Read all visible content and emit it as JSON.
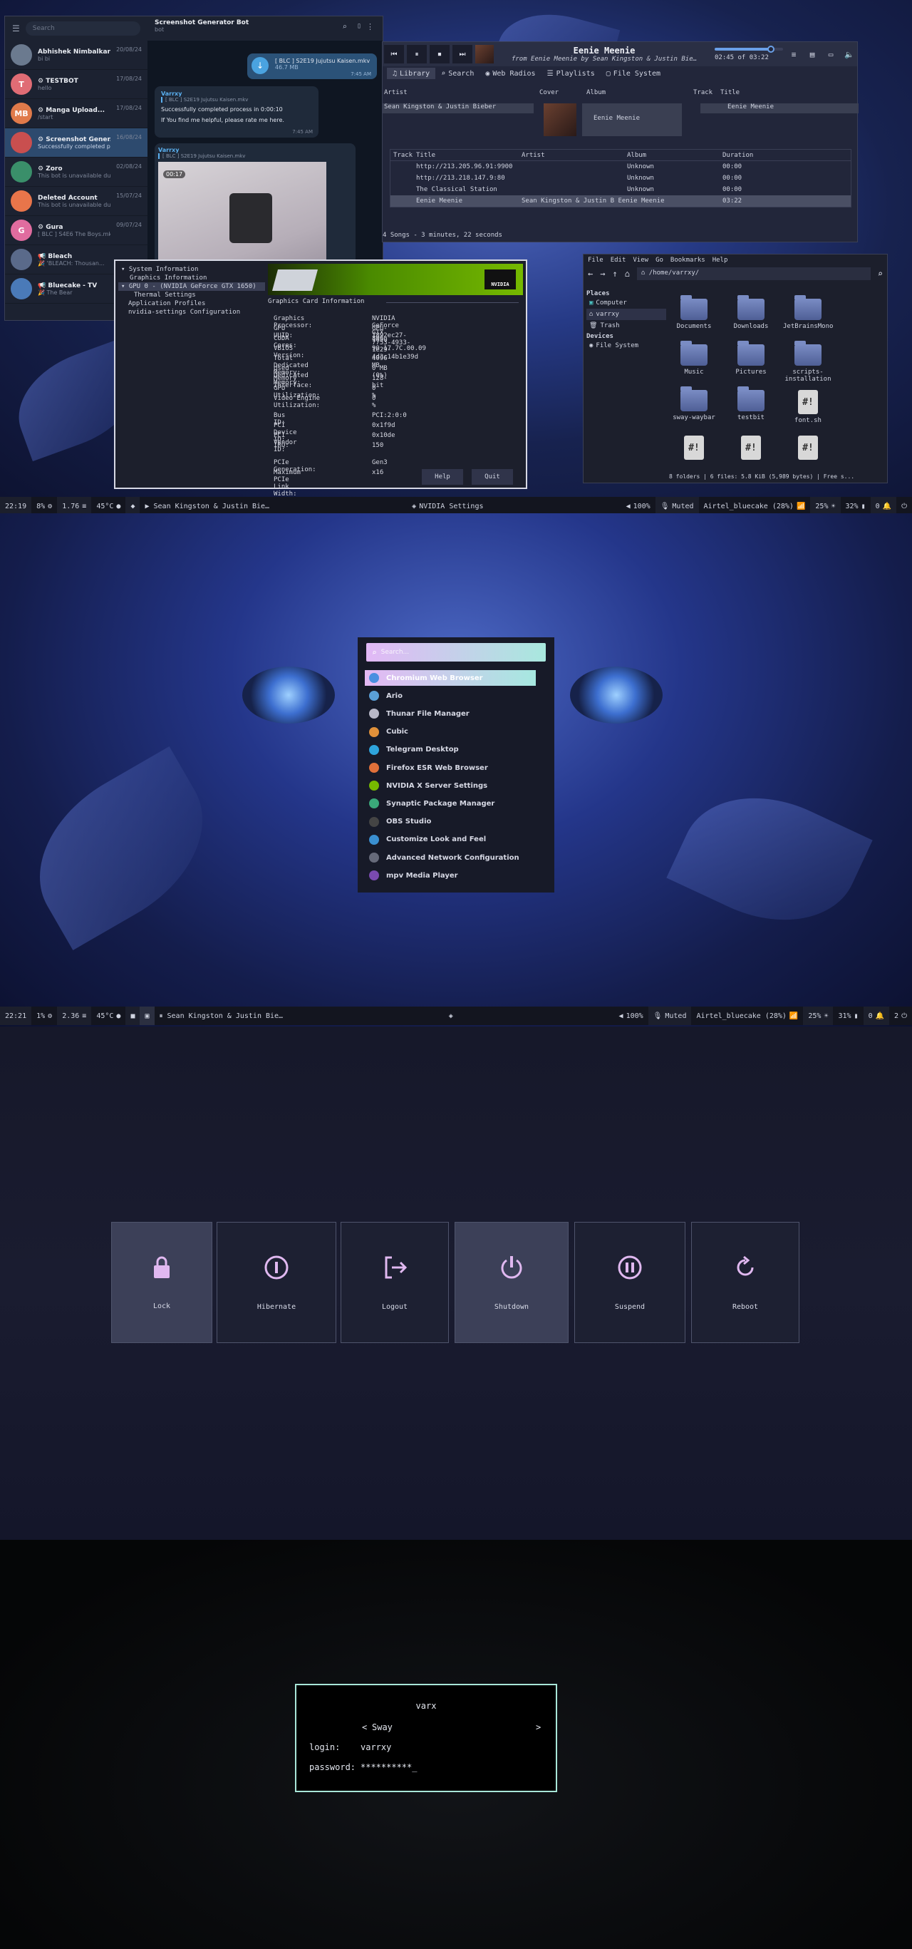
{
  "screen1": {
    "telegram": {
      "search_placeholder": "Search",
      "chat_title": "Screenshot Generator Bot",
      "chat_subtitle": "bot",
      "chats": [
        {
          "name": "Abhishek Nimbalkar",
          "preview": "bi bi",
          "date": "20/08/24",
          "avatar": "",
          "color": "#6b7a8f"
        },
        {
          "name": "⚙ TESTBOT",
          "preview": "hello",
          "date": "17/08/24",
          "avatar": "T",
          "color": "#e06c75"
        },
        {
          "name": "⚙ Manga Upload...",
          "preview": "/start",
          "date": "17/08/24",
          "avatar": "MB",
          "color": "#e07a4a"
        },
        {
          "name": "⚙ Screenshot Gener...",
          "preview": "Successfully completed process...",
          "date": "16/08/24",
          "avatar": "",
          "color": "#c94f4f"
        },
        {
          "name": "⚙ Zoro",
          "preview": "This bot is unavailable due to c...",
          "date": "02/08/24",
          "avatar": "",
          "color": "#3a8f6a"
        },
        {
          "name": "Deleted Account",
          "preview": "This bot is unavailable due to c...",
          "date": "15/07/24",
          "avatar": "",
          "color": "#e8754a"
        },
        {
          "name": "⚙ Gura",
          "preview": "[ BLC ] S4E6 The Boys.mkv",
          "date": "09/07/24",
          "avatar": "G",
          "color": "#e06c9f"
        },
        {
          "name": "📢 Bleach",
          "preview": "🎉 'BLEACH: Thousan...",
          "date": "",
          "avatar": "",
          "color": "#5a6a8a"
        },
        {
          "name": "📢 Bluecake - TV",
          "preview": "🎉 The Bear",
          "date": "",
          "avatar": "",
          "color": "#4a7ab8"
        }
      ],
      "file_name": "[ BLC ] S2E19 Jujutsu Kaisen.mkv",
      "file_size": "46.7 MB",
      "file_time": "7:45 AM",
      "msg1_sender": "Varrxy",
      "msg1_quote": "[ BLC ] S2E19 Jujutsu Kaisen.mkv",
      "msg1_text": "Successfully completed process in 0:00:10",
      "msg1_text2": "If You find me helpful, please rate me here.",
      "msg1_time": "7:45 AM",
      "msg2_sender": "Varrxy",
      "msg2_quote": "[ BLC ] S2E19 Jujutsu Kaisen.mkv",
      "video_time": "00:17"
    },
    "music": {
      "title": "Eenie Meenie",
      "subtitle": "from Eenie Meenie by Sean Kingston & Justin Bie…",
      "time": "02:45 of 03:22",
      "progress": 0.82,
      "tabs": [
        "Library",
        "Search",
        "Web Radios",
        "Playlists",
        "File System"
      ],
      "headers_top": [
        "Artist",
        "Cover",
        "Album",
        "Track",
        "Title"
      ],
      "artist_row": "Sean Kingston & Justin Bieber",
      "album_row": "Eenie Meenie",
      "title_row": "Eenie Meenie",
      "track_headers": [
        "Track",
        "Title",
        "Artist",
        "Album",
        "Duration"
      ],
      "tracks": [
        {
          "title": "http://213.205.96.91:9900",
          "artist": "",
          "album": "Unknown",
          "duration": "00:00"
        },
        {
          "title": "http://213.218.147.9:80",
          "artist": "",
          "album": "Unknown",
          "duration": "00:00"
        },
        {
          "title": "The Classical Station",
          "artist": "",
          "album": "Unknown",
          "duration": "00:00"
        },
        {
          "title": "Eenie Meenie",
          "artist": "Sean Kingston & Justin B Eenie Meenie",
          "album": "",
          "duration": "03:22"
        }
      ],
      "status": "4 Songs - 3 minutes, 22 seconds"
    },
    "nvidia": {
      "tree": [
        "System Information",
        "Graphics Information",
        "GPU 0 - (NVIDIA GeForce GTX 1650)",
        "Thermal Settings",
        "Application Profiles",
        "nvidia-settings Configuration"
      ],
      "section_title": "Graphics Card Information",
      "logo_text": "NVIDIA",
      "keys": [
        "Graphics Processor:",
        "GPU UUID:",
        "CUDA Cores:",
        "VBIOS Version:",
        "Total Dedicated Memory:",
        "Used Dedicated Memory:",
        "Memory Interface:",
        "GPU Utilization:",
        "Video Engine Utilization:",
        "Bus ID:",
        "PCI Device ID:",
        "PCI Vendor ID:",
        "IRQ:",
        "PCIe Generation:",
        "Maximum PCIe Link Width:"
      ],
      "values": [
        "NVIDIA GeForce GTX 1650",
        "GPU-1892ec27-7753-4933-1e29-4d3c14b1e39d",
        "896",
        "90.17.7C.00.09",
        "4096 MB",
        "0 MB (0%)",
        "128-bit",
        "0 %",
        "0 %",
        "PCI:2:0:0",
        "0x1f9d",
        "0x10de",
        "150",
        "Gen3",
        "x16"
      ],
      "help": "Help",
      "quit": "Quit"
    },
    "files": {
      "menu": [
        "File",
        "Edit",
        "View",
        "Go",
        "Bookmarks",
        "Help"
      ],
      "path": "/home/varrxy/",
      "places_label": "Places",
      "places": [
        "Computer",
        "varrxy",
        "Trash"
      ],
      "devices_label": "Devices",
      "devices": [
        "File System"
      ],
      "items": [
        "Documents",
        "Downloads",
        "JetBrainsMono",
        "Music",
        "Pictures",
        "scripts-installation",
        "sway-waybar",
        "testbit",
        "font.sh",
        "",
        "",
        ""
      ],
      "script_glyph": "#!",
      "status": "8 folders  |  6 files: 5.8 KiB (5,989 bytes)  |  Free s..."
    },
    "bar": {
      "time": "22:19",
      "cpu": "8%",
      "load": "1.76",
      "temp": "45°C",
      "media": "▶ Sean Kingston & Justin Bie…",
      "window": "NVIDIA Settings",
      "volume": "100%",
      "mic": "Muted",
      "wifi": "Airtel_bluecake (28%)",
      "brightness": "25%",
      "battery": "32%",
      "notif": "0"
    }
  },
  "screen2": {
    "launcher_placeholder": "Search...",
    "apps": [
      "Chromium Web Browser",
      "Ario",
      "Thunar File Manager",
      "Cubic",
      "Telegram Desktop",
      "Firefox ESR Web Browser",
      "NVIDIA X Server Settings",
      "Synaptic Package Manager",
      "OBS Studio",
      "Customize Look and Feel",
      "Advanced Network Configuration",
      "mpv Media Player"
    ],
    "app_colors": [
      "#4a8fe0",
      "#5aa0d8",
      "#b8b8c8",
      "#e0903a",
      "#2ea4dc",
      "#e0703a",
      "#76b900",
      "#3aa87a",
      "#444444",
      "#3a8fd0",
      "#666a7a",
      "#7a4ab0"
    ],
    "bar": {
      "time": "22:21",
      "cpu": "1%",
      "load": "2.36",
      "temp": "45°C",
      "media": "⏸ Sean Kingston & Justin Bie…",
      "volume": "100%",
      "mic": "Muted",
      "wifi": "Airtel_bluecake (28%)",
      "brightness": "25%",
      "battery": "31%",
      "notif": "0",
      "ws": "2"
    }
  },
  "screen3": {
    "buttons": [
      "Lock",
      "Hibernate",
      "Logout",
      "Shutdown",
      "Suspend",
      "Reboot"
    ]
  },
  "screen4": {
    "hostname": "varx",
    "session": "Sway",
    "login_label": "login:",
    "login_value": "varrxy",
    "password_label": "password:",
    "password_value": "**********_"
  }
}
